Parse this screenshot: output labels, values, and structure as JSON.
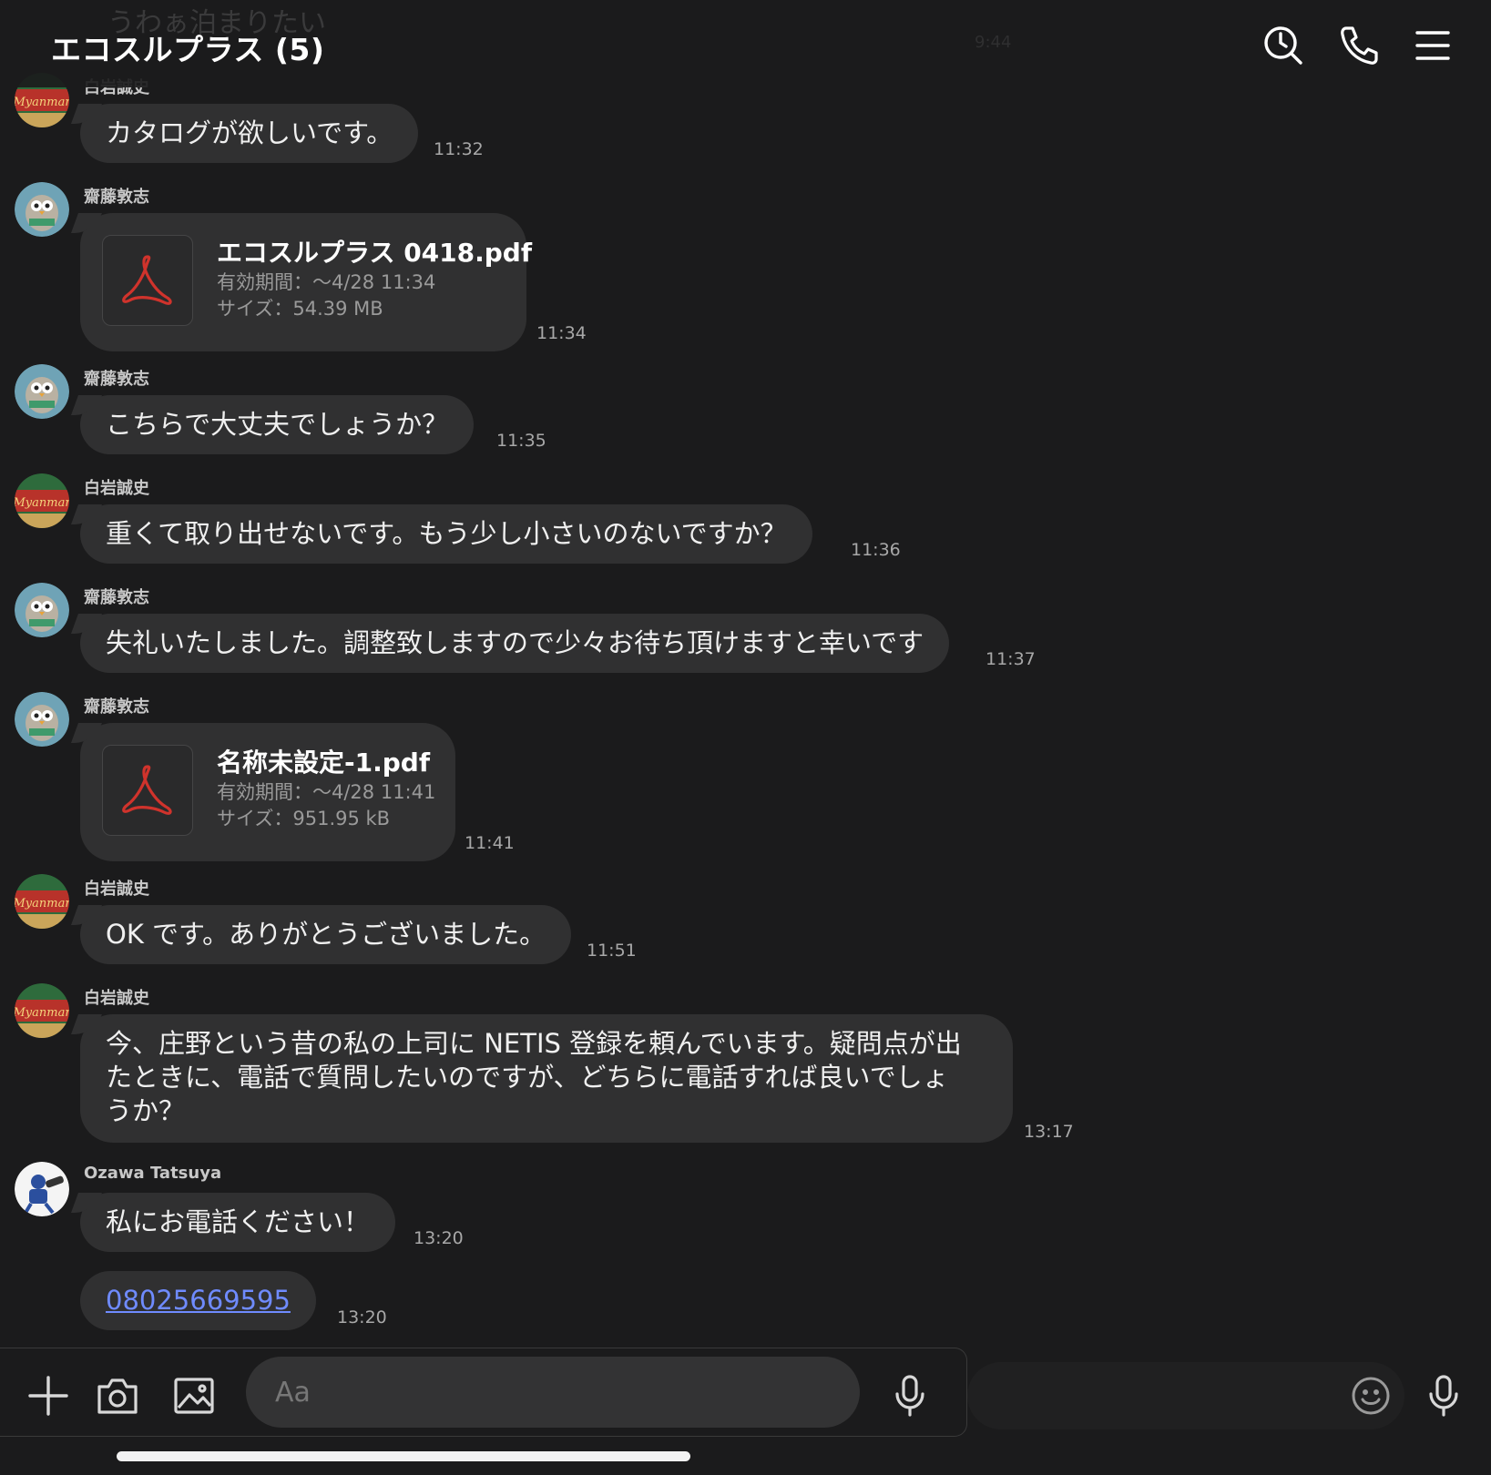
{
  "header": {
    "title": "エコスルプラス (5)",
    "ghost_text": "うわぁ泊まりたい",
    "ghost_time": "9:44",
    "icons": [
      "clock-search-icon",
      "phone-icon",
      "menu-icon"
    ]
  },
  "messages": [
    {
      "sender": "白岩誠史",
      "text": "カタログが欲しいです。",
      "time": "11:32",
      "avatar": "myanmar-beer-avatar"
    },
    {
      "sender": "齋藤敦志",
      "type": "file",
      "file_name": "エコスルプラス 0418.pdf",
      "expiry": "有効期間：〜4/28 11:34",
      "size": "サイズ：54.39 MB",
      "time": "11:34",
      "avatar": "owl-avatar"
    },
    {
      "sender": "齋藤敦志",
      "text": "こちらで大丈夫でしょうか？",
      "time": "11:35",
      "avatar": "owl-avatar"
    },
    {
      "sender": "白岩誠史",
      "text": "重くて取り出せないです。もう少し小さいのないですか？",
      "time": "11:36",
      "avatar": "myanmar-beer-avatar"
    },
    {
      "sender": "齋藤敦志",
      "text": "失礼いたしました。調整致しますので少々お待ち頂けますと幸いです",
      "time": "11:37",
      "avatar": "owl-avatar"
    },
    {
      "sender": "齋藤敦志",
      "type": "file",
      "file_name": "名称未設定-1.pdf",
      "expiry": "有効期間：〜4/28 11:41",
      "size": "サイズ：951.95 kB",
      "time": "11:41",
      "avatar": "owl-avatar"
    },
    {
      "sender": "白岩誠史",
      "text": "OK です。ありがとうございました。",
      "time": "11:51",
      "avatar": "myanmar-beer-avatar"
    },
    {
      "sender": "白岩誠史",
      "text_lines": [
        "今、庄野という昔の私の上司に NETIS 登録を頼んでいます。疑問点が出",
        "たときに、電話で質問したいのですが、どちらに電話すれば良いでしょ",
        "うか？"
      ],
      "time": "13:17",
      "avatar": "myanmar-beer-avatar"
    },
    {
      "sender": "Ozawa Tatsuya",
      "text": "私にお電話ください！",
      "time": "13:20",
      "avatar": "player-avatar"
    },
    {
      "type": "link",
      "text": "08025669595",
      "time": "13:20"
    }
  ],
  "composer": {
    "placeholder": "Aa",
    "icons": [
      "plus-icon",
      "camera-icon",
      "image-icon",
      "microphone-icon",
      "emoji-icon",
      "voice-icon"
    ]
  },
  "colors": {
    "background": "#1b1b1c",
    "bubble": "#303031",
    "link": "#6f8bff",
    "pdf_red": "#d0332c"
  }
}
